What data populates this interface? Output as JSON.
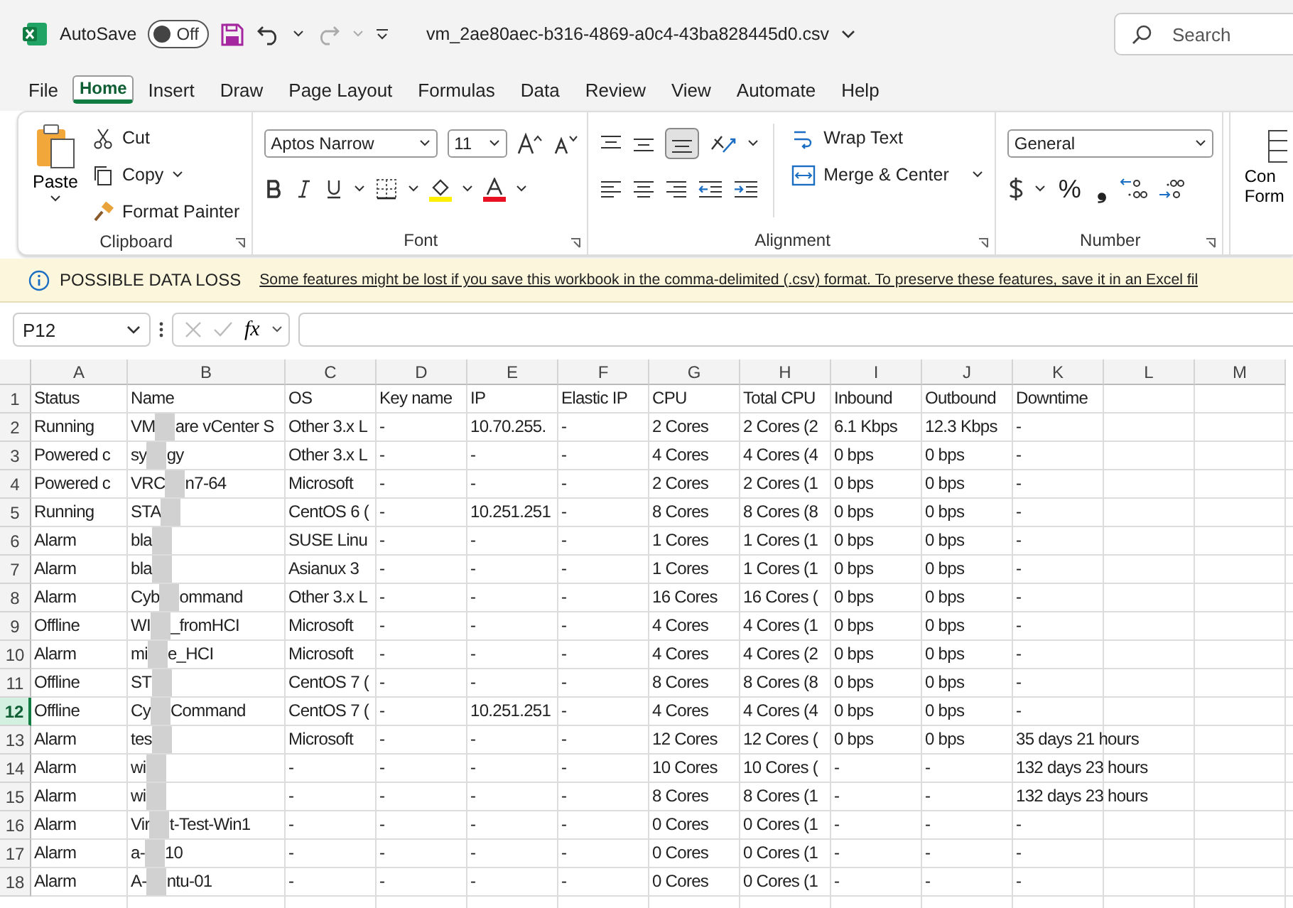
{
  "title_bar": {
    "autosave_label": "AutoSave",
    "autosave_on": false,
    "toggle_text": "Off",
    "file_name": "vm_2ae80aec-b316-4869-a0c4-43ba828445d0.csv",
    "search_placeholder": "Search"
  },
  "menu_tabs": [
    {
      "label": "File",
      "selected": false
    },
    {
      "label": "Home",
      "selected": true
    },
    {
      "label": "Insert",
      "selected": false
    },
    {
      "label": "Draw",
      "selected": false
    },
    {
      "label": "Page Layout",
      "selected": false
    },
    {
      "label": "Formulas",
      "selected": false
    },
    {
      "label": "Data",
      "selected": false
    },
    {
      "label": "Review",
      "selected": false
    },
    {
      "label": "View",
      "selected": false
    },
    {
      "label": "Automate",
      "selected": false
    },
    {
      "label": "Help",
      "selected": false
    }
  ],
  "ribbon": {
    "clipboard": {
      "paste": "Paste",
      "cut": "Cut",
      "copy": "Copy",
      "format_painter": "Format Painter",
      "label": "Clipboard"
    },
    "font": {
      "font_name": "Aptos Narrow",
      "font_size": "11",
      "label": "Font"
    },
    "alignment": {
      "wrap_text": "Wrap Text",
      "merge_center": "Merge & Center",
      "label": "Alignment"
    },
    "number": {
      "format": "General",
      "percent": "%",
      "comma": "❟",
      "label": "Number"
    },
    "cut_group": [
      "Con",
      "Form"
    ]
  },
  "info_bar": {
    "title": "POSSIBLE DATA LOSS",
    "message": "Some features might be lost if you save this workbook in the comma-delimited (.csv) format. To preserve these features, save it in an Excel fil"
  },
  "formula_bar": {
    "name_box": "P12",
    "fx": "fx"
  },
  "sheet": {
    "columns": [
      "A",
      "B",
      "C",
      "D",
      "E",
      "F",
      "G",
      "H",
      "I",
      "J",
      "K",
      "L",
      "M"
    ],
    "rows": [
      {
        "number": "1",
        "selected": false,
        "cells": [
          "Status",
          "Name",
          "OS",
          "Key name",
          "IP",
          "Elastic IP",
          "CPU",
          "Total CPU",
          "Inbound",
          "Outbound",
          "Downtime"
        ]
      },
      {
        "number": "2",
        "selected": false,
        "cells": [
          "Running",
          {
            "kind": "redacted",
            "before": "VM",
            "after": "are vCenter S"
          },
          "Other 3.x L",
          "-",
          "10.70.255.",
          "-",
          "2 Cores",
          "2 Cores (2",
          "6.1 Kbps",
          "12.3 Kbps",
          "-"
        ]
      },
      {
        "number": "3",
        "selected": false,
        "cells": [
          "Powered c",
          {
            "kind": "redacted",
            "before": "sy",
            "after": "gy"
          },
          "Other 3.x L",
          "-",
          "-",
          "-",
          "4 Cores",
          "4 Cores (4",
          "0 bps",
          "0 bps",
          "-"
        ]
      },
      {
        "number": "4",
        "selected": false,
        "cells": [
          "Powered c",
          {
            "kind": "redacted",
            "before": "VRC",
            "after": "n7-64"
          },
          "Microsoft",
          "-",
          "-",
          "-",
          "2 Cores",
          "2 Cores (1",
          "0 bps",
          "0 bps",
          "-"
        ]
      },
      {
        "number": "5",
        "selected": false,
        "cells": [
          "Running",
          {
            "kind": "redacted",
            "before": "STA"
          },
          "CentOS 6 (",
          "-",
          "10.251.251",
          "-",
          "8 Cores",
          "8 Cores (8",
          "0 bps",
          "0 bps",
          "-"
        ]
      },
      {
        "number": "6",
        "selected": false,
        "cells": [
          "Alarm",
          {
            "kind": "redacted",
            "before": "bla"
          },
          "SUSE Linu",
          "-",
          "-",
          "-",
          "1 Cores",
          "1 Cores (1",
          "0 bps",
          "0 bps",
          "-"
        ]
      },
      {
        "number": "7",
        "selected": false,
        "cells": [
          "Alarm",
          {
            "kind": "redacted",
            "before": "bla"
          },
          "Asianux 3",
          "-",
          "-",
          "-",
          "1 Cores",
          "1 Cores (1",
          "0 bps",
          "0 bps",
          "-"
        ]
      },
      {
        "number": "8",
        "selected": false,
        "cells": [
          "Alarm",
          {
            "kind": "redacted",
            "before": "Cyb",
            "after": "ommand"
          },
          "Other 3.x L",
          "-",
          "-",
          "-",
          "16 Cores",
          "16 Cores (",
          "0 bps",
          "0 bps",
          "-"
        ]
      },
      {
        "number": "9",
        "selected": false,
        "cells": [
          "Offline",
          {
            "kind": "redacted",
            "before": "WI",
            "after": "_fromHCI"
          },
          "Microsoft",
          "-",
          "-",
          "-",
          "4 Cores",
          "4 Cores (1",
          "0 bps",
          "0 bps",
          "-"
        ]
      },
      {
        "number": "10",
        "selected": false,
        "cells": [
          "Alarm",
          {
            "kind": "redacted",
            "before": "mi",
            "after": "e_HCI"
          },
          "Microsoft",
          "-",
          "-",
          "-",
          "4 Cores",
          "4 Cores (2",
          "0 bps",
          "0 bps",
          "-"
        ]
      },
      {
        "number": "11",
        "selected": false,
        "cells": [
          "Offline",
          {
            "kind": "redacted",
            "before": "ST"
          },
          "CentOS 7 (",
          "-",
          "-",
          "-",
          "8 Cores",
          "8 Cores (8",
          "0 bps",
          "0 bps",
          "-"
        ]
      },
      {
        "number": "12",
        "selected": true,
        "cells": [
          "Offline",
          {
            "kind": "redacted",
            "before": "Cy",
            "after": "Command"
          },
          "CentOS 7 (",
          "-",
          "10.251.251",
          "-",
          "4 Cores",
          "4 Cores (4",
          "0 bps",
          "0 bps",
          "-"
        ]
      },
      {
        "number": "13",
        "selected": false,
        "cells": [
          "Alarm",
          {
            "kind": "redacted",
            "before": "tes"
          },
          "Microsoft",
          "-",
          "-",
          "-",
          "12 Cores",
          "12 Cores (",
          "0 bps",
          "0 bps",
          "35 days 21 hours"
        ]
      },
      {
        "number": "14",
        "selected": false,
        "cells": [
          "Alarm",
          {
            "kind": "redacted",
            "before": "wi"
          },
          "-",
          "-",
          "-",
          "-",
          "10 Cores",
          "10 Cores (",
          "-",
          "-",
          "132 days 23 hours"
        ]
      },
      {
        "number": "15",
        "selected": false,
        "cells": [
          "Alarm",
          {
            "kind": "redacted",
            "before": "wi"
          },
          "-",
          "-",
          "-",
          "-",
          "8 Cores",
          "8 Cores (1",
          "-",
          "-",
          "132 days 23 hours"
        ]
      },
      {
        "number": "16",
        "selected": false,
        "cells": [
          "Alarm",
          {
            "kind": "redacted",
            "before": "Vir",
            "after": "t-Test-Win1"
          },
          "-",
          "-",
          "-",
          "-",
          "0 Cores",
          "0 Cores (1",
          "-",
          "-",
          "-"
        ]
      },
      {
        "number": "17",
        "selected": false,
        "cells": [
          "Alarm",
          {
            "kind": "redacted",
            "before": "a-",
            "after": "10"
          },
          "-",
          "-",
          "-",
          "-",
          "0 Cores",
          "0 Cores (1",
          "-",
          "-",
          "-"
        ]
      },
      {
        "number": "18",
        "selected": false,
        "cells": [
          "Alarm",
          {
            "kind": "redacted",
            "before": "A-",
            "after": "ntu-01"
          },
          "-",
          "-",
          "-",
          "-",
          "0 Cores",
          "0 Cores (1",
          "-",
          "-",
          "-"
        ]
      }
    ]
  }
}
